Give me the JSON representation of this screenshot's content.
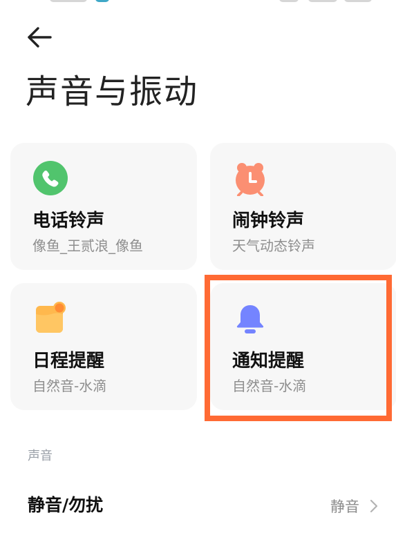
{
  "header": {
    "title": "声音与振动",
    "back_icon": "arrow-left-icon"
  },
  "cards": {
    "phone": {
      "title": "电话铃声",
      "subtitle": "像鱼_王贰浪_像鱼",
      "icon": "phone-icon",
      "color": "#51c46d"
    },
    "alarm": {
      "title": "闹钟铃声",
      "subtitle": "天气动态铃声",
      "icon": "alarm-clock-icon",
      "color": "#fb8f72"
    },
    "schedule": {
      "title": "日程提醒",
      "subtitle": "自然音-水滴",
      "icon": "calendar-note-icon",
      "color": "#ffbd54"
    },
    "notification": {
      "title": "通知提醒",
      "subtitle": "自然音-水滴",
      "icon": "bell-icon",
      "color": "#7484ff",
      "highlighted": true
    }
  },
  "sound_section": {
    "heading": "声音",
    "rows": [
      {
        "label": "静音/勿扰",
        "value": "静音",
        "icon": "chevron-right-icon"
      }
    ]
  },
  "colors": {
    "highlight": "#ff6a34",
    "card_background": "#f7f7f7",
    "title_text": "#222222",
    "secondary_text": "#8e8e8e"
  }
}
